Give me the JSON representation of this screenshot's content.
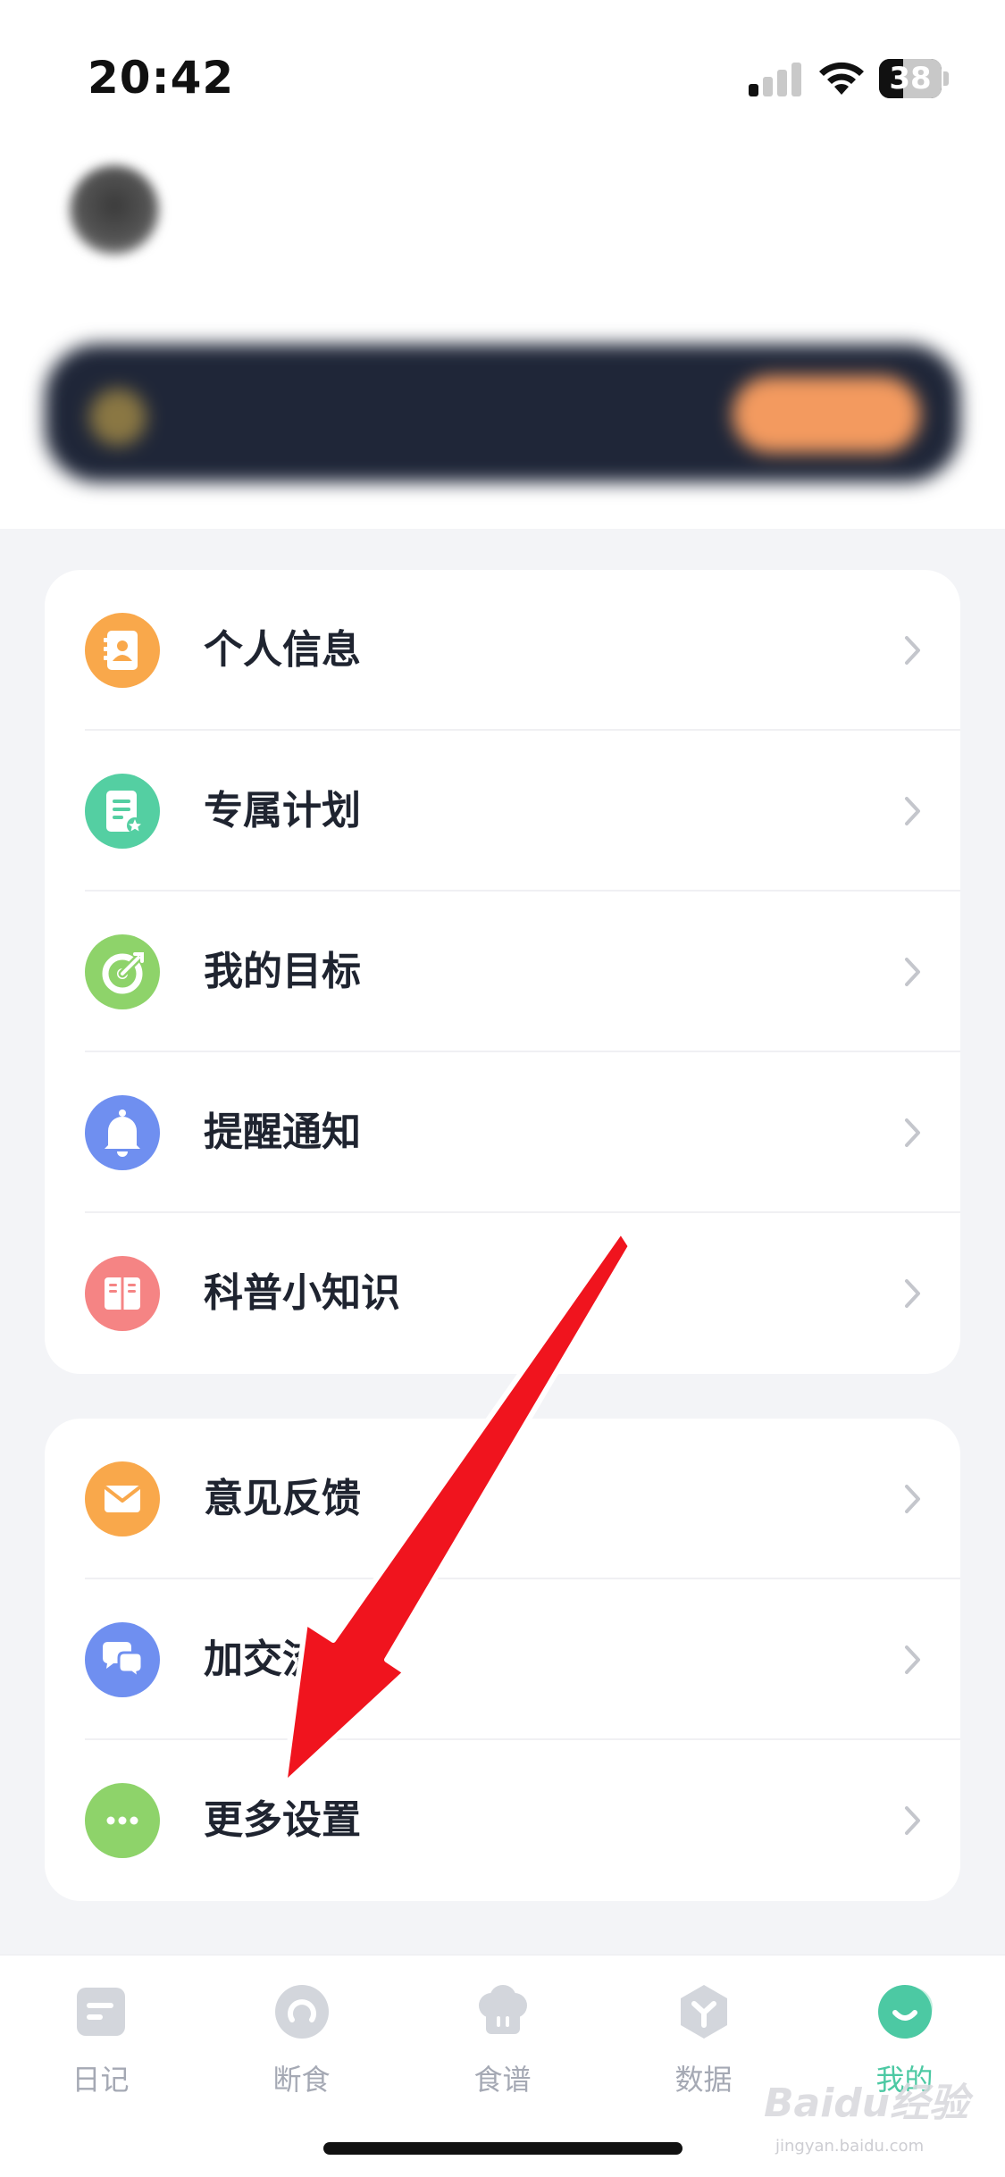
{
  "status_bar": {
    "time": "20:42",
    "battery_percent": "38",
    "battery_level": 0.38,
    "signal_bars_active": 1,
    "signal_bars_total": 4
  },
  "profile": {
    "name": "",
    "subtitle": ""
  },
  "vip_banner": {
    "text": "",
    "button_label": ""
  },
  "menu_group_1": [
    {
      "label": "个人信息",
      "icon": "contact-card-icon",
      "color": "#F9A84B"
    },
    {
      "label": "专属计划",
      "icon": "plan-document-icon",
      "color": "#54CFA2"
    },
    {
      "label": "我的目标",
      "icon": "target-icon",
      "color": "#8ED36A"
    },
    {
      "label": "提醒通知",
      "icon": "bell-icon",
      "color": "#6F8FF0"
    },
    {
      "label": "科普小知识",
      "icon": "book-icon",
      "color": "#F58484"
    }
  ],
  "menu_group_2": [
    {
      "label": "意见反馈",
      "icon": "mail-icon",
      "color": "#F9A84B"
    },
    {
      "label": "加交流群",
      "icon": "chat-bubbles-icon",
      "color": "#6F8FF0"
    },
    {
      "label": "更多设置",
      "icon": "more-dots-icon",
      "color": "#8ED36A"
    }
  ],
  "tab_bar": [
    {
      "label": "日记",
      "icon": "diary-icon",
      "active": false
    },
    {
      "label": "断食",
      "icon": "fasting-timer-icon",
      "active": false
    },
    {
      "label": "食谱",
      "icon": "chef-hat-icon",
      "active": false
    },
    {
      "label": "数据",
      "icon": "data-hexagon-icon",
      "active": false
    },
    {
      "label": "我的",
      "icon": "profile-smile-icon",
      "active": true
    }
  ],
  "colors": {
    "accent": "#4CC9A3",
    "annotation_arrow": "#F0141E",
    "inactive_tab": "#A5A9B4"
  },
  "watermark": {
    "brand": "Baidu经验",
    "url": "jingyan.baidu.com"
  }
}
